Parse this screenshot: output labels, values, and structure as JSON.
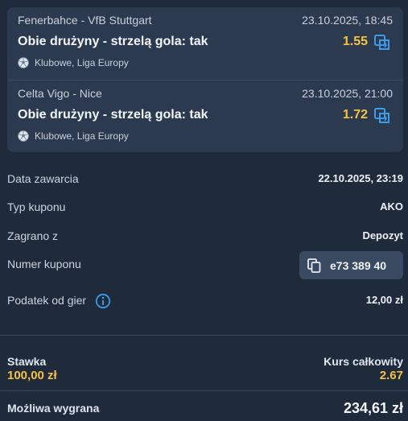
{
  "events": [
    {
      "teams": "Fenerbahce - VfB Stuttgart",
      "datetime": "23.10.2025, 18:45",
      "selection": "Obie drużyny - strzelą gola: tak",
      "odds": "1.55",
      "league": "Klubowe, Liga Europy",
      "icon": "odds-boost-icon"
    },
    {
      "teams": "Celta Vigo - Nice",
      "datetime": "23.10.2025, 21:00",
      "selection": "Obie drużyny - strzelą gola: tak",
      "odds": "1.72",
      "league": "Klubowe, Liga Europy",
      "icon": "odds-boost-icon"
    }
  ],
  "details": {
    "date_label": "Data zawarcia",
    "date_value": "22.10.2025, 23:19",
    "type_label": "Typ kuponu",
    "type_value": "AKO",
    "played_label": "Zagrano z",
    "played_value": "Depozyt",
    "coupon_label": "Numer kuponu",
    "coupon_value": "e73 389 40",
    "tax_label": "Podatek od gier",
    "tax_value": "12,00 zł"
  },
  "summary": {
    "stake_label": "Stawka",
    "stake_value": "100,00 zł",
    "total_odds_label": "Kurs całkowity",
    "total_odds_value": "2.67",
    "win_label": "Możliwa wygrana",
    "win_value": "234,61 zł"
  },
  "colors": {
    "background": "#1f2a3b",
    "card": "#2c3a4f",
    "accent_yellow": "#f5c342",
    "icon_blue": "#3d9be9"
  }
}
